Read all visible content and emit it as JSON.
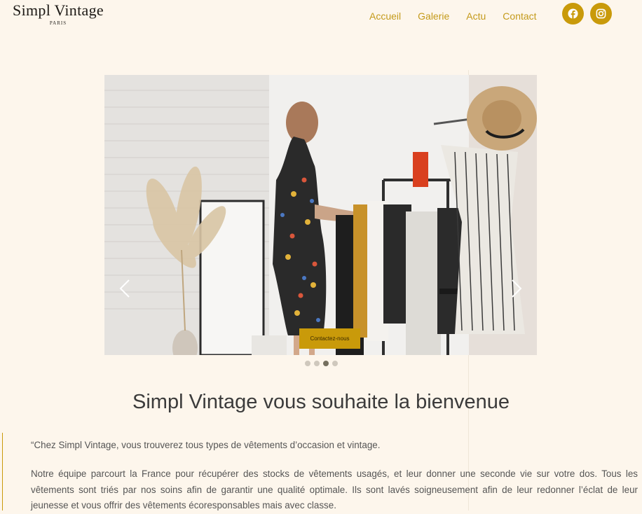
{
  "brand": {
    "name": "Simpl Vintage",
    "subtitle": "PARIS"
  },
  "nav": {
    "items": [
      "Accueil",
      "Galerie",
      "Actu",
      "Contact"
    ]
  },
  "social": {
    "facebook": "facebook-icon",
    "instagram": "instagram-icon"
  },
  "colors": {
    "accent": "#c99a0a",
    "nav_text": "#c49a1a",
    "background": "#fdf6ec"
  },
  "hero": {
    "cta_label": "Contactez-nous",
    "slides_total": 4,
    "active_slide": 3
  },
  "content": {
    "heading": "Simpl Vintage vous souhaite la bienvenue",
    "quote_line": "“Chez Simpl Vintage, vous trouverez tous types de vêtements d’occasion et vintage.",
    "paragraph": "Notre équipe parcourt la France pour récupérer des stocks de vêtements usagés, et leur donner une seconde vie sur votre dos. Tous les vêtements sont triés par nos soins afin de garantir une qualité optimale. Ils sont lavés soigneusement afin de leur redonner l’éclat de leur jeunesse et vous offrir des vêtements écoresponsables mais avec classe."
  }
}
